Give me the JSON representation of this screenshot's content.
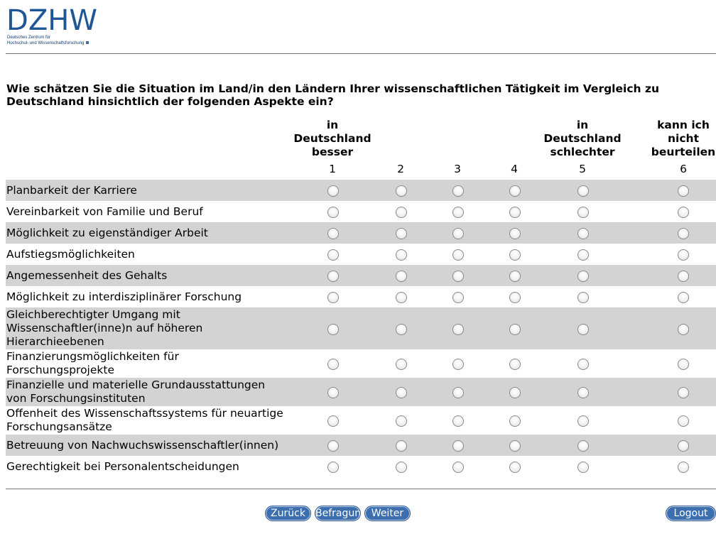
{
  "logo": {
    "wordmark": "DZHW",
    "line1": "Deutsches Zentrum für",
    "line2": "Hochschul- und Wissenschaftsforschung",
    "color": "#1f5796"
  },
  "question": "Wie schätzen Sie die Situation im Land/in den Ländern Ihrer wissenschaftlichen Tätigkeit im Vergleich zu Deutschland hinsichtlich der folgenden Aspekte ein?",
  "scale": {
    "header_1": "in Deutschland besser",
    "header_5": "in Deutschland schlechter",
    "header_6": "kann ich nicht beurteilen",
    "numbers": [
      "1",
      "2",
      "3",
      "4",
      "5",
      "6"
    ]
  },
  "items": [
    "Planbarkeit der Karriere",
    "Vereinbarkeit von Familie und Beruf",
    "Möglichkeit zu eigenständiger Arbeit",
    "Aufstiegsmöglichkeiten",
    "Angemessenheit des Gehalts",
    "Möglichkeit zu interdisziplinärer Forschung",
    "Gleichberechtigter Umgang mit Wissenschaftler(inne)n auf höheren Hierarchieebenen",
    "Finanzierungsmöglichkeiten für Forschungsprojekte",
    "Finanzielle und materielle Grundausstattungen von Forschungsinstituten",
    "Offenheit des Wissenschaftssystems für neuartige Forschungsansätze",
    "Betreuung von Nachwuchswissenschaftler(innen)",
    "Gerechtigkeit bei Personalentscheidungen"
  ],
  "buttons": {
    "back": "Zurück",
    "survey": "Befragung",
    "next": "Weiter",
    "logout": "Logout"
  },
  "colors": {
    "button": "#3d6fb0",
    "row_shade": "#d3d3d3"
  }
}
